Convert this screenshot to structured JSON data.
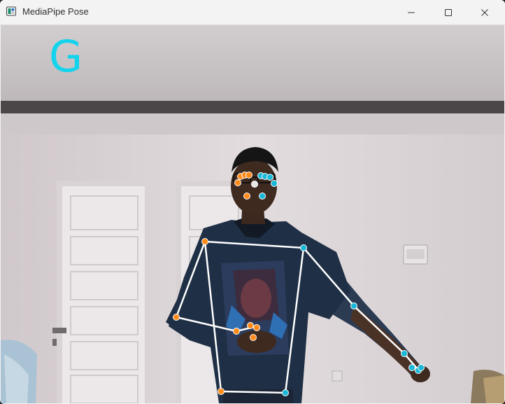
{
  "window": {
    "title": "MediaPipe Pose",
    "icons": {
      "app": "window-app-icon",
      "minimize": "minimize-icon",
      "maximize": "maximize-icon",
      "close": "close-icon"
    }
  },
  "overlay": {
    "gesture_label": "G",
    "label_color": "#12d4ec"
  },
  "pose": {
    "left_side_color": "#ff8c1a",
    "right_side_color": "#1ab8d8",
    "connection_color": "#ffffff"
  },
  "colors": {
    "titlebar": "#f3f3f3",
    "wall": "#dcd6d8",
    "ceiling": "#c9c4c6",
    "door": "#ebe7e8",
    "shirt": "#1f2f45"
  }
}
